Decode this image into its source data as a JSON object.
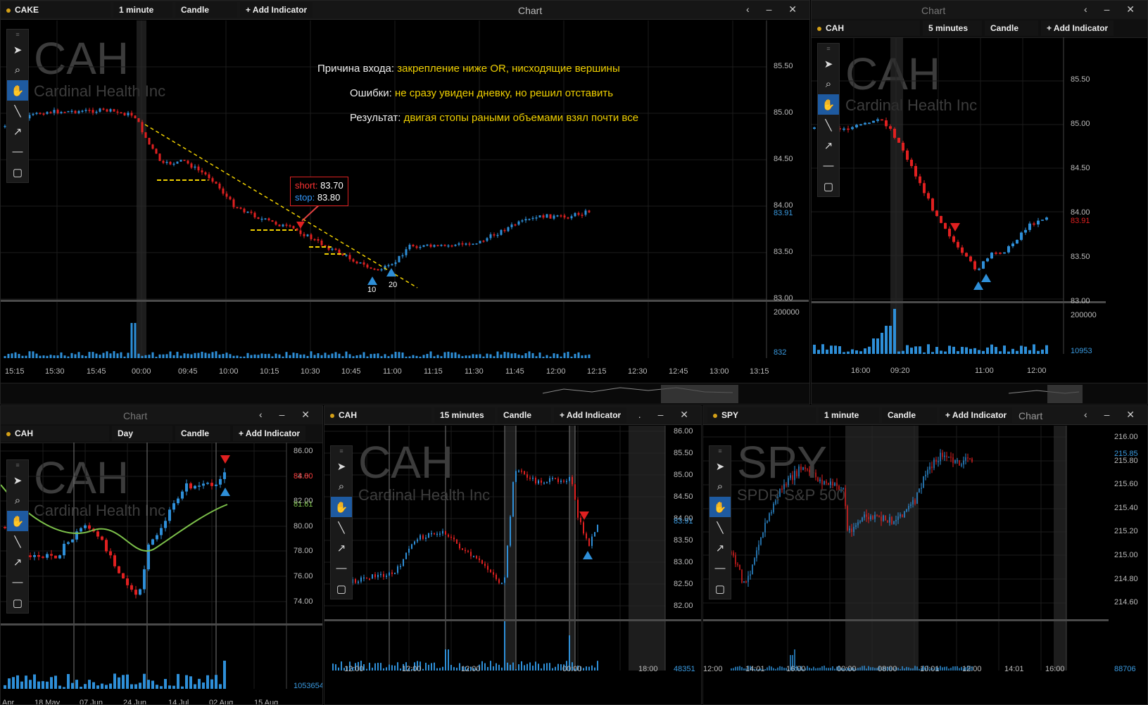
{
  "main": {
    "toolbar": {
      "symbol": "CAKE",
      "interval": "1 minute",
      "style": "Candle",
      "indicator": "+ Add Indicator"
    },
    "title": "Chart",
    "controls": [
      "‹",
      "–",
      "✕"
    ],
    "watermark": {
      "symbol": "CAH",
      "name": "Cardinal Health Inc"
    },
    "notes": [
      {
        "label": "Причина входа:",
        "text": "закрепление ниже OR, нисходящие вершины"
      },
      {
        "label": "Ошибки:",
        "text": "не сразу увиден дневку, но решил отставить"
      },
      {
        "label": "Результат:",
        "text": "двигая стопы раными объемами взял почти все"
      }
    ],
    "order_box": {
      "short_label": "short:",
      "short_value": "83.70",
      "stop_label": "stop:",
      "stop_value": "83.80"
    },
    "markers": [
      "10",
      "20"
    ],
    "y_labels": [
      "85.50",
      "85.00",
      "84.50",
      "84.00",
      "83.50",
      "83.00"
    ],
    "last_price": "83.91",
    "vol_labels": [
      "200000",
      "832"
    ],
    "x_labels": [
      "15:15",
      "15:30",
      "15:45",
      "00:00",
      "09:45",
      "10:00",
      "10:15",
      "10:30",
      "10:45",
      "11:00",
      "11:15",
      "11:30",
      "11:45",
      "12:00",
      "12:15",
      "12:30",
      "12:45",
      "13:00",
      "13:15"
    ]
  },
  "top_right": {
    "title": "Chart",
    "controls": [
      "‹",
      "–",
      "✕"
    ],
    "toolbar": {
      "symbol": "CAH",
      "interval": "5 minutes",
      "style": "Candle",
      "indicator": "+ Add Indicator"
    },
    "watermark": {
      "symbol": "CAH",
      "name": "Cardinal Health Inc"
    },
    "y_labels": [
      "85.50",
      "85.00",
      "84.50",
      "84.00",
      "83.50",
      "83.00"
    ],
    "last_price": "83.91",
    "vol_labels": [
      "200000",
      "10953"
    ],
    "x_labels": [
      "16:00",
      "09:20",
      "11:00",
      "12:00"
    ]
  },
  "bottom_left": {
    "title": "Chart",
    "controls": [
      "‹",
      "–",
      "✕"
    ],
    "toolbar": {
      "symbol": "CAH",
      "interval": "Day",
      "style": "Candle",
      "indicator": "+ Add Indicator"
    },
    "watermark": {
      "symbol": "CAH",
      "name": "Cardinal Health Inc"
    },
    "y_labels": [
      "86.00",
      "84.00",
      "82.00",
      "80.00",
      "78.00",
      "76.00",
      "74.00"
    ],
    "last_price": "83.80",
    "ma_value": "81.61",
    "vol_label": "1053654",
    "x_labels": [
      "Apr",
      "18 May",
      "07 Jun",
      "24 Jun",
      "14 Jul",
      "02 Aug",
      "15 Aug"
    ]
  },
  "bottom_mid": {
    "toolbar": {
      "symbol": "CAH",
      "interval": "15 minutes",
      "style": "Candle",
      "indicator": "+ Add Indicator"
    },
    "controls": [
      ".",
      "–",
      "✕"
    ],
    "watermark": {
      "symbol": "CAH",
      "name": "Cardinal Health Inc"
    },
    "y_labels": [
      "86.00",
      "85.50",
      "85.00",
      "84.50",
      "84.00",
      "83.50",
      "83.00",
      "82.50",
      "82.00"
    ],
    "last_price": "83.91",
    "vol_label": "48351",
    "x_labels": [
      "12:00",
      "12:00",
      "12:00",
      "00:00",
      "18:00"
    ]
  },
  "bottom_right": {
    "toolbar": {
      "symbol": "SPY",
      "interval": "1 minute",
      "style": "Candle",
      "indicator": "+ Add Indicator"
    },
    "title": "Chart",
    "controls": [
      "‹",
      "–",
      "✕"
    ],
    "watermark": {
      "symbol": "SPY",
      "name": "SPDR S&P 500"
    },
    "y_labels": [
      "216.00",
      "215.80",
      "215.60",
      "215.40",
      "215.20",
      "215.00",
      "214.80",
      "214.60"
    ],
    "last_price": "215.85",
    "vol_label": "88706",
    "x_labels": [
      "12:00",
      "14:01",
      "16:00",
      "00:00",
      "08:00",
      "10:01",
      "12:00",
      "14:01",
      "16:00"
    ]
  },
  "tool_icons": [
    "pointer-icon",
    "zoom-icon",
    "hand-icon",
    "line-icon",
    "arrow-icon",
    "hline-icon",
    "rect-icon"
  ],
  "colors": {
    "up": "#2e8fd8",
    "down": "#e02020",
    "accent": "#1e5aa0",
    "annotation": "#f0d000",
    "ma": "#7cc04a"
  }
}
